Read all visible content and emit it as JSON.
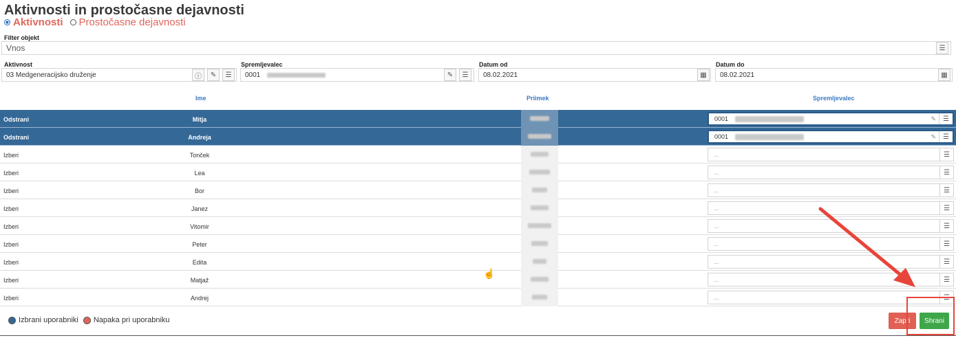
{
  "page": {
    "title": "Aktivnosti in prostočasne dejavnosti"
  },
  "modes": [
    {
      "label": "Aktivnosti",
      "selected": true
    },
    {
      "label": "Prostočasne dejavnosti",
      "selected": false
    }
  ],
  "filter": {
    "label": "Filter objekt",
    "value": "Vnos"
  },
  "aktivnost": {
    "label": "Aktivnost",
    "value": "03 Medgeneracijsko druženje"
  },
  "spremljevalec": {
    "label": "Spremljevalec",
    "value": "0001"
  },
  "datum_od": {
    "label": "Datum od",
    "value": "08.02.2021"
  },
  "datum_do": {
    "label": "Datum do",
    "value": "08.02.2021"
  },
  "table": {
    "headers": [
      "Ime",
      "Priimek",
      "Spremljevalec"
    ],
    "rows": [
      {
        "action": "Odstrani",
        "ime": "Mitja",
        "spremljevalec": "0001",
        "selected": true
      },
      {
        "action": "Odstrani",
        "ime": "Andreja",
        "spremljevalec": "0001",
        "selected": true
      },
      {
        "action": "Izberi",
        "ime": "Tonček",
        "spremljevalec": "...",
        "selected": false
      },
      {
        "action": "Izberi",
        "ime": "Lea",
        "spremljevalec": "...",
        "selected": false
      },
      {
        "action": "Izberi",
        "ime": "Bor",
        "spremljevalec": "...",
        "selected": false
      },
      {
        "action": "Izberi",
        "ime": "Janez",
        "spremljevalec": "...",
        "selected": false
      },
      {
        "action": "Izberi",
        "ime": "Vitomir",
        "spremljevalec": "...",
        "selected": false
      },
      {
        "action": "Izberi",
        "ime": "Peter",
        "spremljevalec": "...",
        "selected": false
      },
      {
        "action": "Izberi",
        "ime": "Edita",
        "spremljevalec": "...",
        "selected": false
      },
      {
        "action": "Izberi",
        "ime": "Matjaž",
        "spremljevalec": "...",
        "selected": false
      },
      {
        "action": "Izberi",
        "ime": "Andrej",
        "spremljevalec": "...",
        "selected": false
      }
    ]
  },
  "legend": [
    {
      "label": "Izbrani uporabniki",
      "color": "#346896"
    },
    {
      "label": "Napaka pri uporabniku",
      "color": "#e0665c"
    }
  ],
  "buttons": {
    "close": "Zapri",
    "save": "Shrani"
  },
  "colors": {
    "selected_row": "#346896",
    "accent": "#e0665c",
    "save": "#3fa74a",
    "close": "#e06055",
    "arrow": "#e8443a"
  },
  "icons": {
    "list": "list-icon",
    "eraser": "eraser-icon",
    "calendar": "calendar-icon",
    "info": "info-icon"
  }
}
